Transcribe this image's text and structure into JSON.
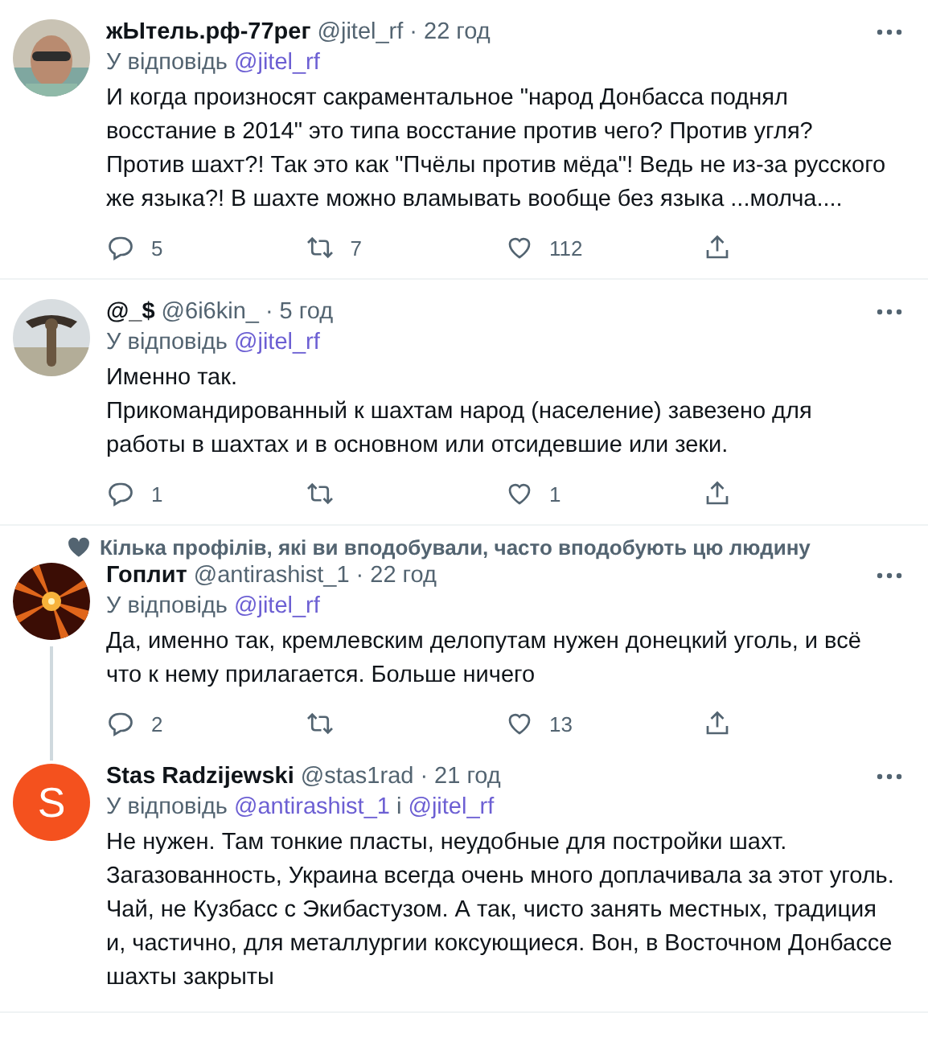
{
  "tweets": [
    {
      "name": "жЫтель.рф-77рег",
      "handle": "@jitel_rf",
      "separator": "·",
      "time": "22 год",
      "reply_to": {
        "prefix": "У відповідь",
        "mentions": [
          "@jitel_rf"
        ]
      },
      "text": "И когда произносят сакраментальное \"народ Донбасса поднял восстание в 2014\" это типа восстание против чего? Против угля? Против шахт?! Так это как \"Пчёлы против мёда\"! Ведь не из-за русского же языка?! В шахте можно вламывать вообще без языка ...молча....",
      "actions": {
        "replies": "5",
        "retweets": "7",
        "likes": "112"
      },
      "thread_below": false
    },
    {
      "name": "@_$",
      "handle": "@6i6kin_",
      "separator": "·",
      "time": "5 год",
      "reply_to": {
        "prefix": "У відповідь",
        "mentions": [
          "@jitel_rf"
        ]
      },
      "text": "Именно так.\nПрикомандированный к шахтам народ (население) завезено для работы в шахтах и в основном или отсидевшие или зеки.",
      "actions": {
        "replies": "1",
        "likes": "1"
      },
      "thread_below": false
    },
    {
      "social_context": "Кілька профілів, які ви вподобували, часто вподобують цю людину",
      "name": "Гоплит",
      "handle": "@antirashist_1",
      "separator": "·",
      "time": "22 год",
      "reply_to": {
        "prefix": "У відповідь",
        "mentions": [
          "@jitel_rf"
        ]
      },
      "text": "Да, именно так, кремлевским делопутам нужен донецкий уголь, и всё что к нему прилагается. Больше ничего",
      "actions": {
        "replies": "2",
        "likes": "13"
      },
      "thread_below": true
    },
    {
      "avatar": {
        "kind": "letter",
        "letter": "S",
        "color": "#f4511e"
      },
      "name": "Stas Radzijewski",
      "handle": "@stas1rad",
      "time": "21 год",
      "reply_to": {
        "prefix": "У відповідь",
        "mentions": [
          "@antirashist_1",
          "@jitel_rf"
        ],
        "joiner": "і"
      },
      "text": "Не нужен. Там тонкие пласты, неудобные для постройки шахт. Загазованность, Украина всегда очень много доплачивала за этот уголь. Чай, не Кузбасс с Экибастузом. А так, чисто занять местных, традиция и,  частично, для металлургии коксующиеся. Вон, в Восточном Донбассе шахты закрыты",
      "separator": "·",
      "thread_below": false
    }
  ]
}
